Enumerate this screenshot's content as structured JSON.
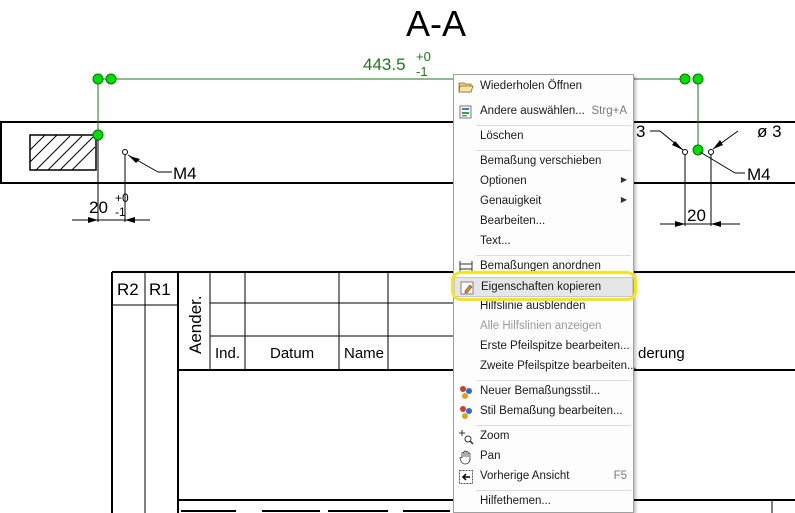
{
  "drawing": {
    "section_title": "A-A",
    "dim_top": {
      "value": "443.5",
      "tol_up": "+0",
      "tol_down": "-1"
    },
    "dim_left": {
      "value": "20",
      "tol_up": "+0",
      "tol_down": "-1"
    },
    "label_m4_left": "M4",
    "label_m4_right": "M4",
    "label_dia": "ø 3",
    "label_three": "3",
    "dim_right": "20",
    "colors": {
      "dim_green": "#1a7a1a",
      "grip": "#00dd00"
    }
  },
  "title_block": {
    "r2": "R2",
    "r1": "R1",
    "aender": "Aender.",
    "ind": "Ind.",
    "datum": "Datum",
    "name": "Name",
    "aenderung_partial": "derung"
  },
  "menu": {
    "items": [
      {
        "label": "Wiederholen Öffnen",
        "icon": "folder-open-icon"
      },
      {
        "label": "Andere auswählen...",
        "shortcut": "Strg+A",
        "icon": "select-others-icon"
      },
      {
        "label": "Löschen"
      },
      {
        "label": "Bemaßung verschieben"
      },
      {
        "label": "Optionen",
        "submenu": true
      },
      {
        "label": "Genauigkeit",
        "submenu": true
      },
      {
        "label": "Bearbeiten..."
      },
      {
        "label": "Text..."
      },
      {
        "label": "Bemaßungen anordnen",
        "icon": "arrange-dimensions-icon"
      },
      {
        "label": "Eigenschaften kopieren",
        "icon": "copy-properties-icon",
        "highlighted": true
      },
      {
        "label": "Hilfslinie ausblenden"
      },
      {
        "label": "Alle Hilfslinien anzeigen",
        "disabled": true
      },
      {
        "label": "Erste Pfeilspitze bearbeiten..."
      },
      {
        "label": "Zweite Pfeilspitze bearbeiten..."
      },
      {
        "label": "Neuer Bemaßungsstil...",
        "icon": "new-style-icon"
      },
      {
        "label": "Stil Bemaßung bearbeiten...",
        "icon": "edit-style-icon"
      },
      {
        "label": "Zoom",
        "icon": "zoom-icon"
      },
      {
        "label": "Pan",
        "icon": "pan-hand-icon"
      },
      {
        "label": "Vorherige Ansicht",
        "shortcut": "F5",
        "icon": "previous-view-icon"
      },
      {
        "label": "Hilfethemen..."
      }
    ]
  }
}
